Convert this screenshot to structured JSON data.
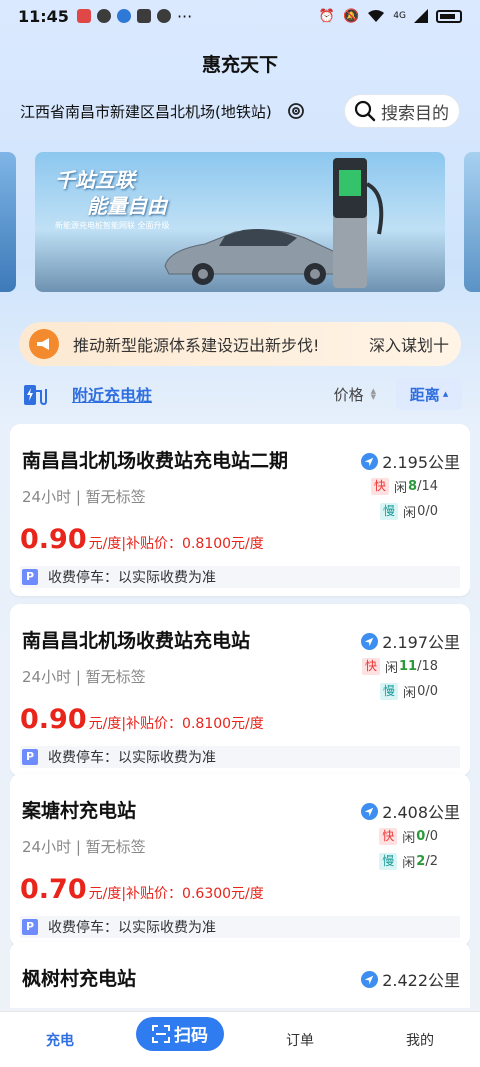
{
  "status_bar": {
    "time": "11:45",
    "more": "···",
    "network": "4G"
  },
  "app_title": "惠充天下",
  "location": {
    "text": "江西省南昌市新建区昌北机场(地铁站)"
  },
  "search": {
    "placeholder": "搜索目的"
  },
  "banner": {
    "slogan_line1": "千站互联",
    "slogan_line2": "能量自由",
    "subtitle": "新能源充电桩智能网联 全面升级"
  },
  "notice": {
    "text": "推动新型能源体系建设迈出新步伐!",
    "link_label": "深入谋划十"
  },
  "filters": {
    "nearby_label": "附近充电桩",
    "price_label": "价格",
    "distance_label": "距离"
  },
  "stations": [
    {
      "name": "南昌昌北机场收费站充电站二期",
      "distance": "2.195公里",
      "meta": "24小时 | 暂无标签",
      "fast_label": "快",
      "fast_free_label": "闲",
      "fast_free": "8",
      "fast_total": "/14",
      "slow_label": "慢",
      "slow_free_label": "闲",
      "slow_free": "0",
      "slow_total": "/0",
      "price": "0.90",
      "price_unit": "元/度|补贴价：0.8100元/度",
      "parking_icon": "P",
      "parking": "收费停车：以实际收费为准"
    },
    {
      "name": "南昌昌北机场收费站充电站",
      "distance": "2.197公里",
      "meta": "24小时 | 暂无标签",
      "fast_label": "快",
      "fast_free_label": "闲",
      "fast_free": "11",
      "fast_total": "/18",
      "slow_label": "慢",
      "slow_free_label": "闲",
      "slow_free": "0",
      "slow_total": "/0",
      "price": "0.90",
      "price_unit": "元/度|补贴价：0.8100元/度",
      "parking_icon": "P",
      "parking": "收费停车：以实际收费为准"
    },
    {
      "name": "案塘村充电站",
      "distance": "2.408公里",
      "meta": "24小时 | 暂无标签",
      "fast_label": "快",
      "fast_free_label": "闲",
      "fast_free": "0",
      "fast_total": "/0",
      "slow_label": "慢",
      "slow_free_label": "闲",
      "slow_free": "2",
      "slow_total": "/2",
      "price": "0.70",
      "price_unit": "元/度|补贴价：0.6300元/度",
      "parking_icon": "P",
      "parking": "收费停车：以实际收费为准"
    },
    {
      "name": "枫树村充电站",
      "distance": "2.422公里"
    }
  ],
  "bottom_nav": {
    "charge": "充电",
    "scan": "扫码",
    "orders": "订单",
    "mine": "我的"
  },
  "colors": {
    "accent": "#2f6fe0",
    "price_red": "#e8241b",
    "free_green": "#2a9a3a",
    "notice_orange": "#f48a2e"
  }
}
